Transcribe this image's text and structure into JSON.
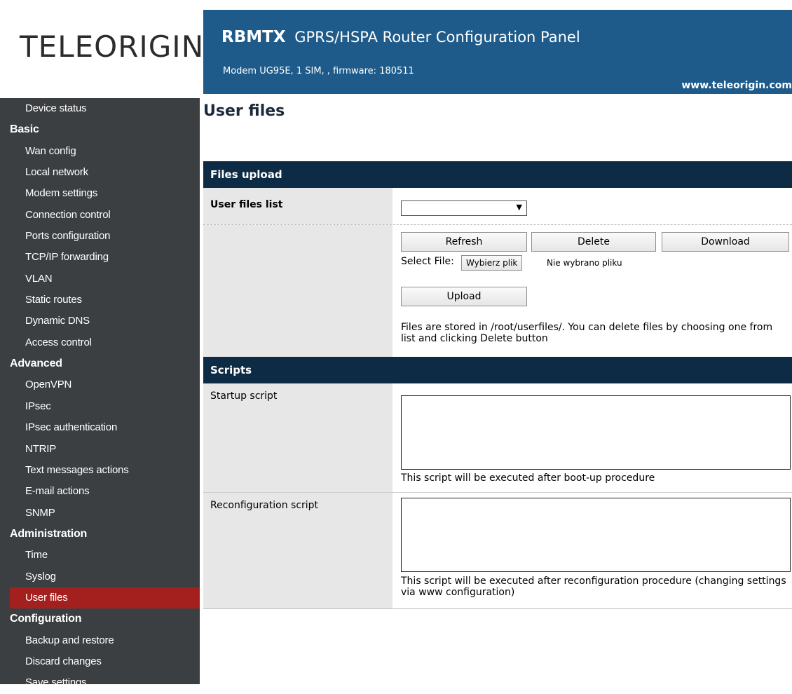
{
  "logo_text": "TELEORIGIN",
  "header": {
    "title_bold": "RBMTX",
    "title_rest": "GPRS/HSPA Router Configuration Panel",
    "subtitle": "Modem UG95E, 1 SIM, , firmware: 180511",
    "url": "www.teleorigin.com"
  },
  "sidebar": {
    "items": [
      {
        "label": "Device status",
        "type": "item"
      },
      {
        "label": "Basic",
        "type": "category"
      },
      {
        "label": "Wan config",
        "type": "item"
      },
      {
        "label": "Local network",
        "type": "item"
      },
      {
        "label": "Modem settings",
        "type": "item"
      },
      {
        "label": "Connection control",
        "type": "item"
      },
      {
        "label": "Ports configuration",
        "type": "item"
      },
      {
        "label": "TCP/IP forwarding",
        "type": "item"
      },
      {
        "label": "VLAN",
        "type": "item"
      },
      {
        "label": "Static routes",
        "type": "item"
      },
      {
        "label": "Dynamic DNS",
        "type": "item"
      },
      {
        "label": "Access control",
        "type": "item"
      },
      {
        "label": "Advanced",
        "type": "category"
      },
      {
        "label": "OpenVPN",
        "type": "item"
      },
      {
        "label": "IPsec",
        "type": "item"
      },
      {
        "label": "IPsec authentication",
        "type": "item"
      },
      {
        "label": "NTRIP",
        "type": "item"
      },
      {
        "label": "Text messages actions",
        "type": "item"
      },
      {
        "label": "E-mail actions",
        "type": "item"
      },
      {
        "label": "SNMP",
        "type": "item"
      },
      {
        "label": "Administration",
        "type": "category"
      },
      {
        "label": "Time",
        "type": "item"
      },
      {
        "label": "Syslog",
        "type": "item"
      },
      {
        "label": "User files",
        "type": "item",
        "active": true
      },
      {
        "label": "Configuration",
        "type": "category"
      },
      {
        "label": "Backup and restore",
        "type": "item"
      },
      {
        "label": "Discard changes",
        "type": "item"
      },
      {
        "label": "Save settings",
        "type": "item"
      }
    ],
    "active_color": "#a3201f",
    "bg_color": "#3c3f42"
  },
  "main": {
    "page_title": "User files",
    "files_upload": {
      "header": "Files upload",
      "user_files_list_label": "User files list",
      "user_files_list_value": "",
      "refresh_label": "Refresh",
      "delete_label": "Delete",
      "download_label": "Download",
      "select_file_label": "Select File:",
      "choose_file_label": "Wybierz plik",
      "no_file_text": "Nie wybrano pliku",
      "upload_label": "Upload",
      "info_text": "Files are stored in /root/userfiles/. You can delete files by choosing one from list and clicking Delete button"
    },
    "scripts": {
      "header": "Scripts",
      "startup_label": "Startup script",
      "startup_value": "",
      "startup_hint": "This script will be executed after boot-up procedure",
      "reconfig_label": "Reconfiguration script",
      "reconfig_value": "",
      "reconfig_hint": "This script will be executed after reconfiguration procedure (changing settings via www configuration)"
    }
  },
  "colors": {
    "header_bg": "#1e5b8a",
    "section_header_bg": "#0e2b45",
    "label_cell_bg": "#e7e7e7"
  }
}
